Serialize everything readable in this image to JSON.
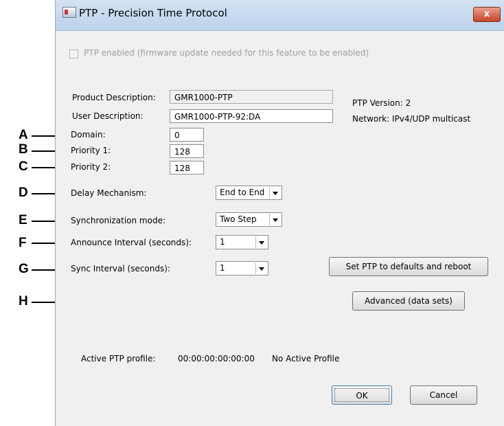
{
  "window": {
    "title": "PTP - Precision Time Protocol",
    "close_label": "x"
  },
  "ptp_enabled": {
    "label": "PTP enabled (firmware update needed for this feature to be enabled)",
    "checked": false
  },
  "product_description": {
    "label": "Product Description:",
    "value": "GMR1000-PTP"
  },
  "user_description": {
    "label": "User Description:",
    "value": "GMR1000-PTP-92:DA"
  },
  "info": {
    "ptp_version": "PTP Version: 2",
    "network": "Network: IPv4/UDP multicast"
  },
  "domain": {
    "label": "Domain:",
    "value": "0"
  },
  "priority1": {
    "label": "Priority 1:",
    "value": "128"
  },
  "priority2": {
    "label": "Priority 2:",
    "value": "128"
  },
  "delay_mechanism": {
    "label": "Delay Mechanism:",
    "value": "End to End"
  },
  "sync_mode": {
    "label": "Synchronization mode:",
    "value": "Two Step"
  },
  "announce_interval": {
    "label": "Announce Interval (seconds):",
    "value": "1"
  },
  "sync_interval": {
    "label": "Sync Interval (seconds):",
    "value": "1"
  },
  "buttons": {
    "defaults": "Set PTP to defaults and reboot",
    "advanced": "Advanced (data sets)",
    "ok": "OK",
    "cancel": "Cancel"
  },
  "active_profile": {
    "label": "Active PTP profile:",
    "id": "00:00:00:00:00:00",
    "name": "No Active Profile"
  },
  "callouts": [
    "A",
    "B",
    "C",
    "D",
    "E",
    "F",
    "G",
    "H"
  ]
}
